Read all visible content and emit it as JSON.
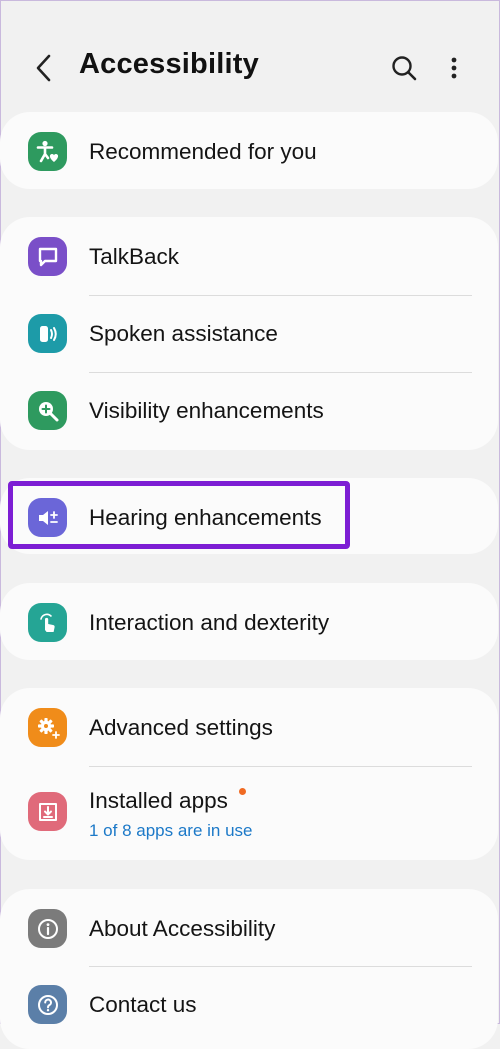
{
  "header": {
    "title": "Accessibility"
  },
  "items": {
    "recommended": {
      "label": "Recommended for you",
      "icon": "accessibility-person-heart-icon",
      "color": "#2e9a5f"
    },
    "talkback": {
      "label": "TalkBack",
      "icon": "speech-bubble-icon",
      "color": "#7a4fc8"
    },
    "spoken": {
      "label": "Spoken assistance",
      "icon": "speaker-waves-icon",
      "color": "#1d9ba8"
    },
    "visibility": {
      "label": "Visibility enhancements",
      "icon": "magnifier-plus-icon",
      "color": "#2e9a5f"
    },
    "hearing": {
      "label": "Hearing enhancements",
      "icon": "speaker-plus-minus-icon",
      "color": "#6b66d8"
    },
    "interaction": {
      "label": "Interaction and dexterity",
      "icon": "hand-tap-icon",
      "color": "#25a595"
    },
    "advanced": {
      "label": "Advanced settings",
      "icon": "gear-plus-icon",
      "color": "#f08c1a"
    },
    "installed": {
      "label": "Installed apps",
      "sublabel": "1 of 8 apps are in use",
      "icon": "download-tray-icon",
      "color": "#e06a7a"
    },
    "about": {
      "label": "About Accessibility",
      "icon": "info-icon",
      "color": "#7b7b7b"
    },
    "contact": {
      "label": "Contact us",
      "icon": "question-icon",
      "color": "#5b7fa8"
    }
  },
  "colors": {
    "highlight": "#7d1ed4",
    "badge": "#f06a22",
    "link": "#1c79c8"
  }
}
